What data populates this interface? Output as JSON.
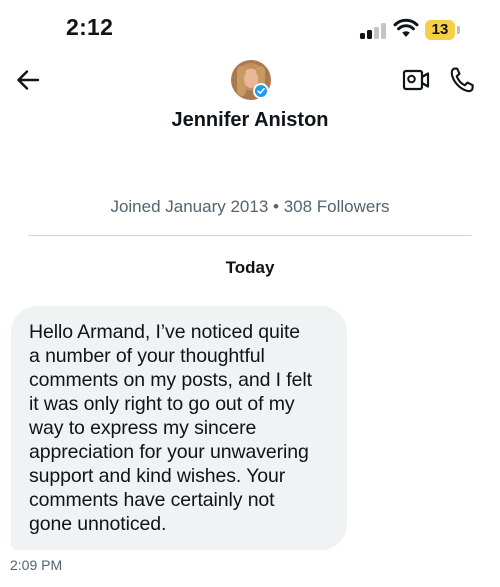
{
  "status_bar": {
    "time": "2:12",
    "battery": "13"
  },
  "header": {
    "name": "Jennifer Aniston",
    "icons": [
      "back-arrow-icon",
      "video-call-icon",
      "phone-call-icon",
      "verified-badge-icon"
    ]
  },
  "profile": {
    "meta": "Joined January 2013 • 308 Followers"
  },
  "conversation": {
    "date_label": "Today",
    "messages": [
      {
        "lines": [
          "Hello Armand, I’ve noticed quite",
          "a number of your thoughtful",
          "comments on my posts, and I felt",
          "it was only right to go out of my",
          "way to express my sincere",
          "appreciation for your unwavering",
          "support and kind wishes. Your",
          "comments have certainly not",
          "gone unnoticed."
        ],
        "time": "2:09 PM"
      }
    ]
  },
  "colors": {
    "accent": "#1d9bf0",
    "bubble": "#eff3f4",
    "muted": "#536471",
    "battery": "#f7cf46"
  }
}
